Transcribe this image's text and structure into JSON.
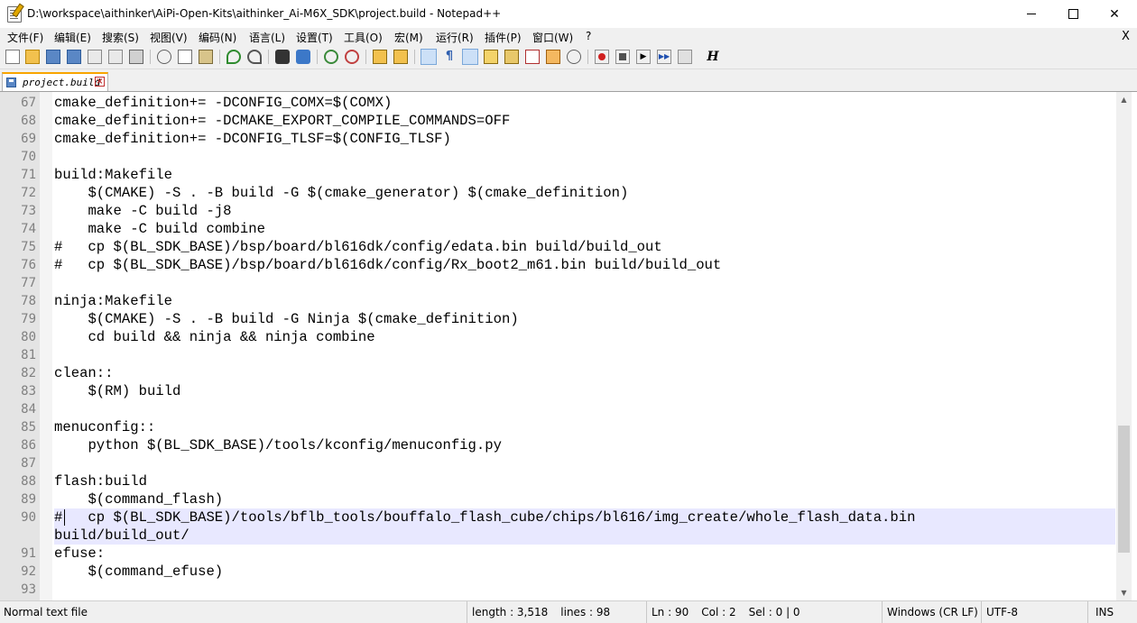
{
  "window": {
    "title": "D:\\workspace\\aithinker\\AiPi-Open-Kits\\aithinker_Ai-M6X_SDK\\project.build - Notepad++",
    "app_icon": "notepad-icon",
    "minimize": "—",
    "maximize": "☐",
    "close": "✕"
  },
  "menu": {
    "items": [
      "文件(F)",
      "编辑(E)",
      "搜索(S)",
      "视图(V)",
      "编码(N)",
      "语言(L)",
      "设置(T)",
      "工具(O)",
      "宏(M)",
      "运行(R)",
      "插件(P)",
      "窗口(W)",
      "?"
    ],
    "close_doc": "X"
  },
  "toolbar": {
    "icons": [
      "new-file-icon",
      "open-file-icon",
      "save-icon",
      "save-all-icon",
      "close-icon",
      "close-all-icon",
      "print-icon",
      "cut-icon",
      "copy-icon",
      "paste-icon",
      "undo-icon",
      "redo-icon",
      "find-icon",
      "replace-icon",
      "zoom-in-icon",
      "zoom-out-icon",
      "sync-vertical-icon",
      "sync-horizontal-icon",
      "word-wrap-icon",
      "show-all-chars-icon",
      "indent-guide-icon",
      "doc-map-icon",
      "function-list-icon",
      "folder-workspace-icon",
      "monitoring-icon",
      "record-macro-icon",
      "stop-macro-icon",
      "play-macro-icon",
      "run-macro-multiple-icon",
      "save-macro-icon",
      "hex-icon"
    ],
    "hex_label": "H"
  },
  "tabs": [
    {
      "label": "project.build",
      "active": true
    }
  ],
  "editor": {
    "current_line": 90,
    "lines": [
      {
        "n": "67",
        "text": "cmake_definition+= -DCONFIG_COMX=$(COMX)"
      },
      {
        "n": "68",
        "text": "cmake_definition+= -DCMAKE_EXPORT_COMPILE_COMMANDS=OFF"
      },
      {
        "n": "69",
        "text": "cmake_definition+= -DCONFIG_TLSF=$(CONFIG_TLSF)"
      },
      {
        "n": "70",
        "text": ""
      },
      {
        "n": "71",
        "text": "build:Makefile"
      },
      {
        "n": "72",
        "text": "    $(CMAKE) -S . -B build -G $(cmake_generator) $(cmake_definition)"
      },
      {
        "n": "73",
        "text": "    make -C build -j8"
      },
      {
        "n": "74",
        "text": "    make -C build combine"
      },
      {
        "n": "75",
        "text": "#   cp $(BL_SDK_BASE)/bsp/board/bl616dk/config/edata.bin build/build_out"
      },
      {
        "n": "76",
        "text": "#   cp $(BL_SDK_BASE)/bsp/board/bl616dk/config/Rx_boot2_m61.bin build/build_out"
      },
      {
        "n": "77",
        "text": ""
      },
      {
        "n": "78",
        "text": "ninja:Makefile"
      },
      {
        "n": "79",
        "text": "    $(CMAKE) -S . -B build -G Ninja $(cmake_definition)"
      },
      {
        "n": "80",
        "text": "    cd build && ninja && ninja combine"
      },
      {
        "n": "81",
        "text": ""
      },
      {
        "n": "82",
        "text": "clean::"
      },
      {
        "n": "83",
        "text": "    $(RM) build"
      },
      {
        "n": "84",
        "text": ""
      },
      {
        "n": "85",
        "text": "menuconfig::"
      },
      {
        "n": "86",
        "text": "    python $(BL_SDK_BASE)/tools/kconfig/menuconfig.py"
      },
      {
        "n": "87",
        "text": ""
      },
      {
        "n": "88",
        "text": "flash:build"
      },
      {
        "n": "89",
        "text": "    $(command_flash)"
      },
      {
        "n": "90",
        "text": "#   cp $(BL_SDK_BASE)/tools/bflb_tools/bouffalo_flash_cube/chips/bl616/img_create/whole_flash_data.bin\nbuild/build_out/",
        "wrapped": true,
        "current": true
      },
      {
        "n": "91",
        "text": "efuse:"
      },
      {
        "n": "92",
        "text": "    $(command_efuse)"
      },
      {
        "n": "93",
        "text": ""
      }
    ]
  },
  "status": {
    "file_type": "Normal text file",
    "length": "length : 3,518",
    "lines": "lines : 98",
    "ln": "Ln : 90",
    "col": "Col : 2",
    "sel": "Sel : 0 | 0",
    "eol": "Windows (CR LF)",
    "encoding": "UTF-8",
    "mode": "INS"
  },
  "colors": {
    "current_line_bg": "#e8e8ff",
    "gutter_bg": "#e4e4e4",
    "tab_accent": "#f8a500"
  }
}
